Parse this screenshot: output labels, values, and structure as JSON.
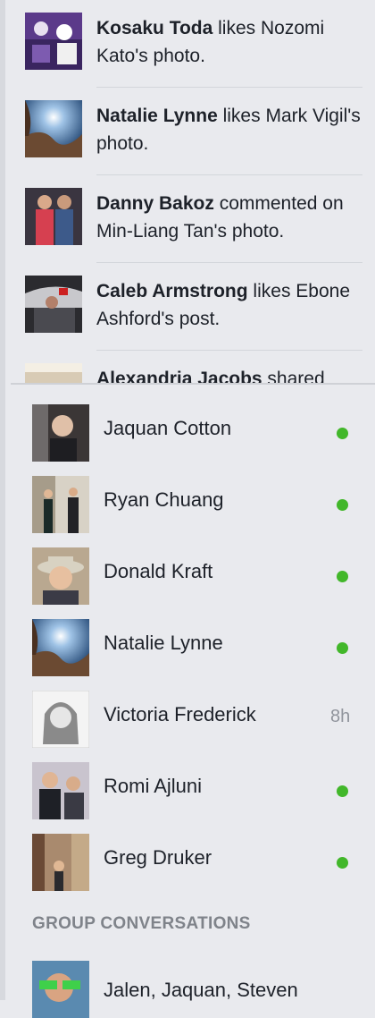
{
  "ticker": [
    {
      "actor": "Kosaku Toda",
      "rest": " likes Nozomi Kato's photo."
    },
    {
      "actor": "Natalie Lynne",
      "rest": " likes Mark Vigil's photo."
    },
    {
      "actor": "Danny Bakoz",
      "rest": " commented on Min-Liang Tan's photo."
    },
    {
      "actor": "Caleb Armstrong",
      "rest": " likes Ebone Ashford's post."
    },
    {
      "actor": "Alexandria Jacobs",
      "rest": " shared"
    }
  ],
  "contacts": [
    {
      "name": "Jaquan Cotton",
      "status": "online",
      "time": ""
    },
    {
      "name": "Ryan Chuang",
      "status": "online",
      "time": ""
    },
    {
      "name": "Donald Kraft",
      "status": "online",
      "time": ""
    },
    {
      "name": "Natalie Lynne",
      "status": "online",
      "time": ""
    },
    {
      "name": "Victoria Frederick",
      "status": "away",
      "time": "8h"
    },
    {
      "name": "Romi Ajluni",
      "status": "online",
      "time": ""
    },
    {
      "name": "Greg Druker",
      "status": "online",
      "time": ""
    }
  ],
  "group_section_title": "GROUP CONVERSATIONS",
  "group_conversations": [
    {
      "name": "Jalen, Jaquan, Steven"
    }
  ],
  "colors": {
    "online": "#42b72a",
    "background": "#e9eaee"
  }
}
